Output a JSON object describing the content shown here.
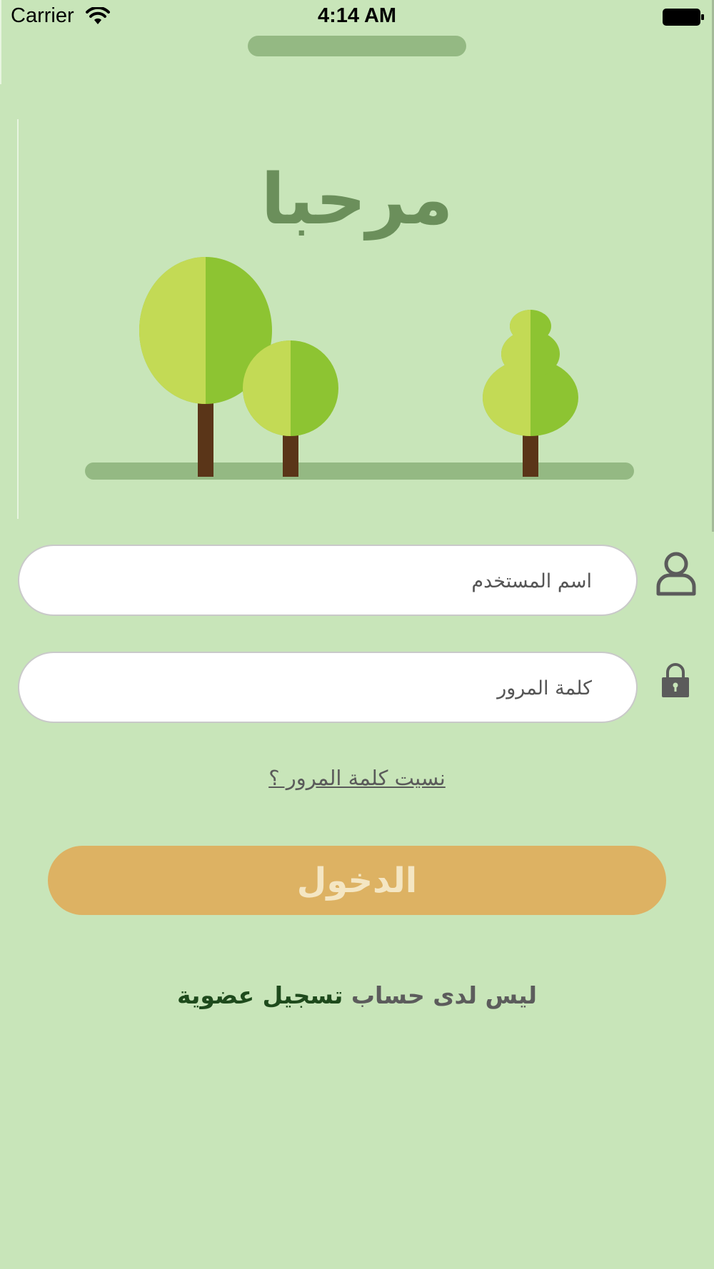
{
  "status_bar": {
    "carrier": "Carrier",
    "time": "4:14 AM",
    "icons": [
      "wifi-icon",
      "battery-icon"
    ]
  },
  "welcome": {
    "title": "مرحبا",
    "illustration": "trees-illustration"
  },
  "form": {
    "username_placeholder": "اسم المستخدم",
    "username_icon": "user-icon",
    "password_placeholder": "كلمة المرور",
    "password_icon": "lock-icon",
    "forgot_password": "نسيت كلمة المرور ؟",
    "login_label": "الدخول"
  },
  "footer": {
    "no_account": "ليس لدى حساب",
    "register": "تسجيل عضوية"
  },
  "colors": {
    "background": "#c8e5b9",
    "title": "#6b8f5b",
    "login_button": "#ddb263",
    "login_text": "#f4e6c3",
    "register_link": "#1e4a1c"
  }
}
